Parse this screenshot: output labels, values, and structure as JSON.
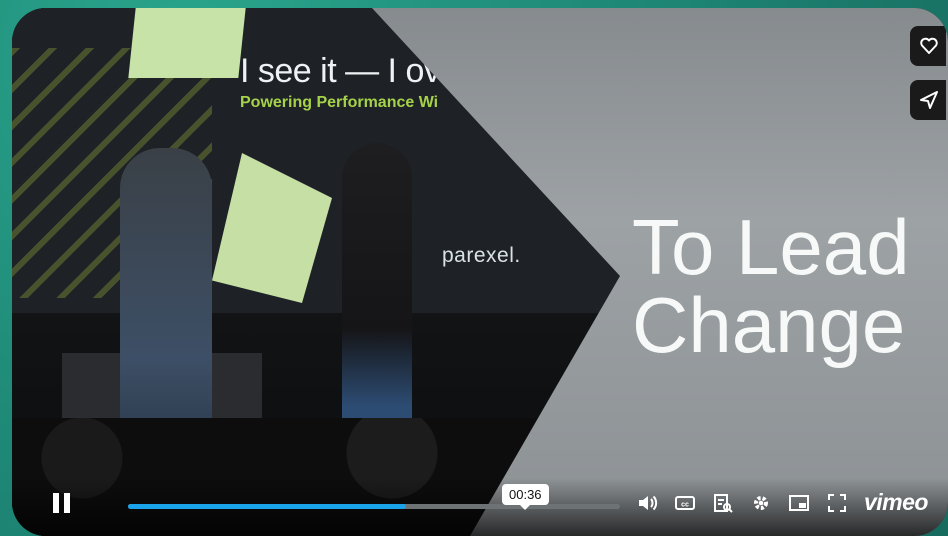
{
  "video": {
    "slide_title": "I see it — I ov",
    "slide_subtitle": "Powering Performance Wi",
    "logo_text": "parexel.",
    "overlay_title": "To Lead Change"
  },
  "side_buttons": [
    {
      "icon": "heart-icon"
    },
    {
      "icon": "share-icon"
    }
  ],
  "controls": {
    "timecode": "00:36",
    "progress_fraction": 0.565,
    "icons": [
      "pause-icon",
      "volume-icon",
      "captions-icon",
      "transcript-icon",
      "settings-icon",
      "pip-icon",
      "fullscreen-icon"
    ],
    "brand": "vimeo"
  },
  "colors": {
    "progress_fill": "#1aa3e8",
    "background": "#1f8a78"
  }
}
